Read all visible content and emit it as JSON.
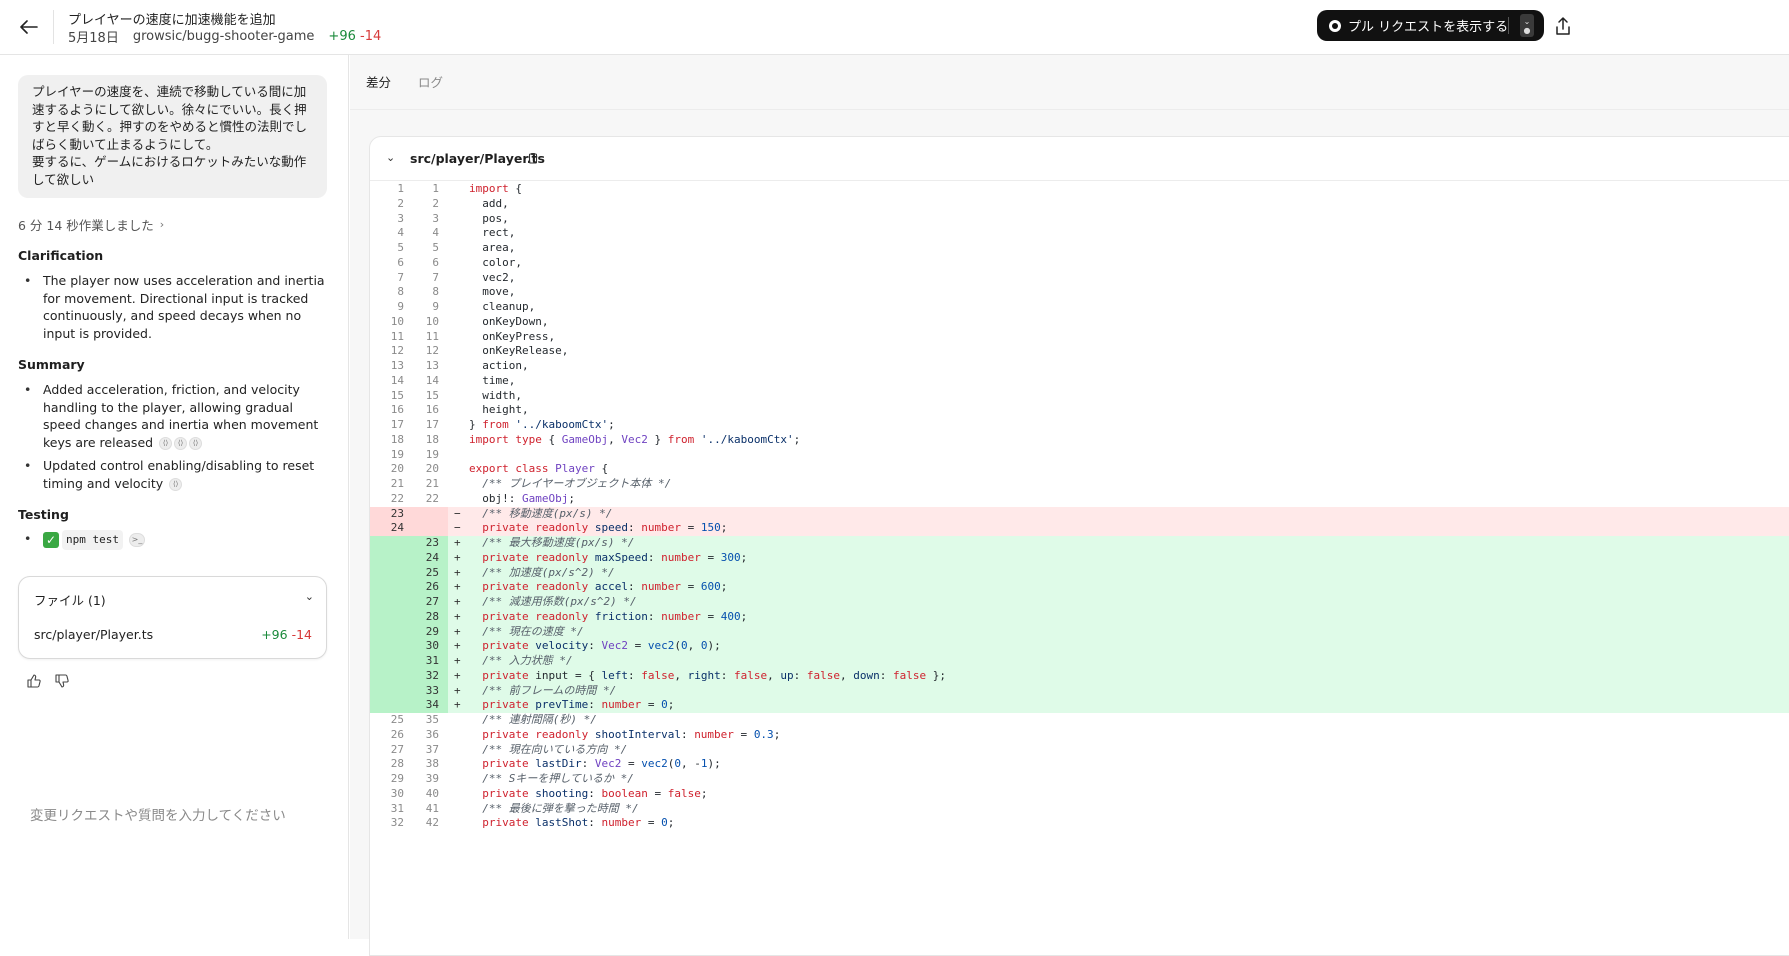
{
  "header": {
    "title": "プレイヤーの速度に加速機能を追加",
    "date": "5月18日",
    "repo": "growsic/bugg-shooter-game",
    "additions": "+96",
    "deletions": "-14",
    "pr_button_label": "プル リクエストを表示する"
  },
  "sidebar": {
    "prompt_lines": [
      "プレイヤーの速度を、連続で移動している間に加",
      "速するようにして欲しい。徐々にでいい。長く押",
      "すと早く動く。押すのをやめると慣性の法則でし",
      "ばらく動いて止まるようにして。",
      "要するに、ゲームにおけるロケットみたいな動作",
      "して欲しい"
    ],
    "worked_label": "6 分 14 秒作業しました",
    "clarification_heading": "Clarification",
    "clarification_items": [
      "The player now uses acceleration and inertia for movement. Directional input is tracked continuously, and speed decays when no input is provided."
    ],
    "summary_heading": "Summary",
    "summary_items": [
      "Added acceleration, friction, and velocity handling to the player, allowing gradual speed changes and inertia when movement keys are released",
      "Updated control enabling/disabling to reset timing and velocity"
    ],
    "testing_heading": "Testing",
    "testing_command": "npm test",
    "files_title": "ファイル (1)",
    "file_name": "src/player/Player.ts",
    "file_additions": "+96",
    "file_deletions": "-14",
    "input_placeholder": "変更リクエストや質問を入力してください"
  },
  "tabs": [
    "差分",
    "ログ"
  ],
  "diff": {
    "file_name": "src/player/Player.ts",
    "lines": [
      {
        "o": "1",
        "n": "1",
        "t": "ctx",
        "c": "import {"
      },
      {
        "o": "2",
        "n": "2",
        "t": "ctx",
        "c": "  add,"
      },
      {
        "o": "3",
        "n": "3",
        "t": "ctx",
        "c": "  pos,"
      },
      {
        "o": "4",
        "n": "4",
        "t": "ctx",
        "c": "  rect,"
      },
      {
        "o": "5",
        "n": "5",
        "t": "ctx",
        "c": "  area,"
      },
      {
        "o": "6",
        "n": "6",
        "t": "ctx",
        "c": "  color,"
      },
      {
        "o": "7",
        "n": "7",
        "t": "ctx",
        "c": "  vec2,"
      },
      {
        "o": "8",
        "n": "8",
        "t": "ctx",
        "c": "  move,"
      },
      {
        "o": "9",
        "n": "9",
        "t": "ctx",
        "c": "  cleanup,"
      },
      {
        "o": "10",
        "n": "10",
        "t": "ctx",
        "c": "  onKeyDown,"
      },
      {
        "o": "11",
        "n": "11",
        "t": "ctx",
        "c": "  onKeyPress,"
      },
      {
        "o": "12",
        "n": "12",
        "t": "ctx",
        "c": "  onKeyRelease,"
      },
      {
        "o": "13",
        "n": "13",
        "t": "ctx",
        "c": "  action,"
      },
      {
        "o": "14",
        "n": "14",
        "t": "ctx",
        "c": "  time,"
      },
      {
        "o": "15",
        "n": "15",
        "t": "ctx",
        "c": "  width,"
      },
      {
        "o": "16",
        "n": "16",
        "t": "ctx",
        "c": "  height,"
      },
      {
        "o": "17",
        "n": "17",
        "t": "ctx",
        "c": "} from '../kaboomCtx';"
      },
      {
        "o": "18",
        "n": "18",
        "t": "ctx",
        "c": "import type { GameObj, Vec2 } from '../kaboomCtx';"
      },
      {
        "o": "19",
        "n": "19",
        "t": "ctx",
        "c": ""
      },
      {
        "o": "20",
        "n": "20",
        "t": "ctx",
        "c": "export class Player {"
      },
      {
        "o": "21",
        "n": "21",
        "t": "ctx",
        "c": "  /** プレイヤーオブジェクト本体 */"
      },
      {
        "o": "22",
        "n": "22",
        "t": "ctx",
        "c": "  obj!: GameObj;"
      },
      {
        "o": "23",
        "n": "",
        "t": "rem",
        "c": "  /** 移動速度(px/s) */"
      },
      {
        "o": "24",
        "n": "",
        "t": "rem",
        "c": "  private readonly speed: number = 150;"
      },
      {
        "o": "",
        "n": "23",
        "t": "add",
        "c": "  /** 最大移動速度(px/s) */"
      },
      {
        "o": "",
        "n": "24",
        "t": "add",
        "c": "  private readonly maxSpeed: number = 300;"
      },
      {
        "o": "",
        "n": "25",
        "t": "add",
        "c": "  /** 加速度(px/s^2) */"
      },
      {
        "o": "",
        "n": "26",
        "t": "add",
        "c": "  private readonly accel: number = 600;"
      },
      {
        "o": "",
        "n": "27",
        "t": "add",
        "c": "  /** 減速用係数(px/s^2) */"
      },
      {
        "o": "",
        "n": "28",
        "t": "add",
        "c": "  private readonly friction: number = 400;"
      },
      {
        "o": "",
        "n": "29",
        "t": "add",
        "c": "  /** 現在の速度 */"
      },
      {
        "o": "",
        "n": "30",
        "t": "add",
        "c": "  private velocity: Vec2 = vec2(0, 0);"
      },
      {
        "o": "",
        "n": "31",
        "t": "add",
        "c": "  /** 入力状態 */"
      },
      {
        "o": "",
        "n": "32",
        "t": "add",
        "c": "  private input = { left: false, right: false, up: false, down: false };"
      },
      {
        "o": "",
        "n": "33",
        "t": "add",
        "c": "  /** 前フレームの時間 */"
      },
      {
        "o": "",
        "n": "34",
        "t": "add",
        "c": "  private prevTime: number = 0;"
      },
      {
        "o": "25",
        "n": "35",
        "t": "ctx",
        "c": "  /** 連射間隔(秒) */"
      },
      {
        "o": "26",
        "n": "36",
        "t": "ctx",
        "c": "  private readonly shootInterval: number = 0.3;"
      },
      {
        "o": "27",
        "n": "37",
        "t": "ctx",
        "c": "  /** 現在向いている方向 */"
      },
      {
        "o": "28",
        "n": "38",
        "t": "ctx",
        "c": "  private lastDir: Vec2 = vec2(0, -1);"
      },
      {
        "o": "29",
        "n": "39",
        "t": "ctx",
        "c": "  /** Sキーを押しているか */"
      },
      {
        "o": "30",
        "n": "40",
        "t": "ctx",
        "c": "  private shooting: boolean = false;"
      },
      {
        "o": "31",
        "n": "41",
        "t": "ctx",
        "c": "  /** 最後に弾を撃った時間 */"
      },
      {
        "o": "32",
        "n": "42",
        "t": "ctx",
        "c": "  private lastShot: number = 0;"
      }
    ]
  }
}
